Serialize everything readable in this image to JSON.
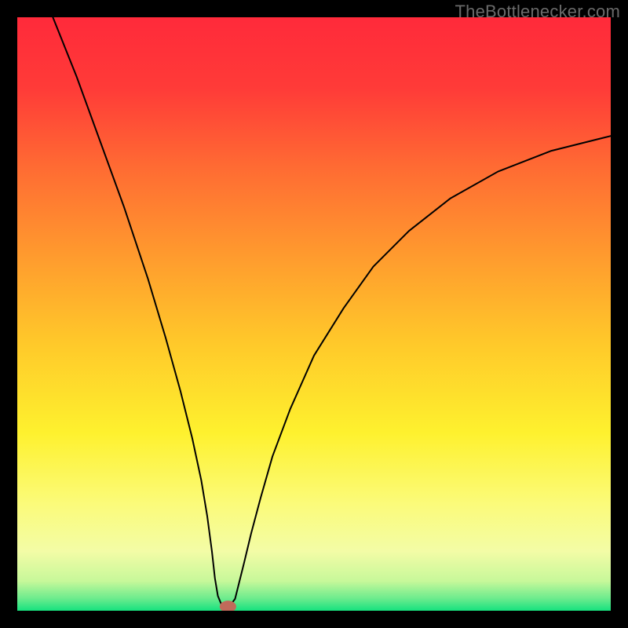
{
  "watermark": "TheBottlenecker.com",
  "chart_data": {
    "type": "line",
    "title": "",
    "xlabel": "",
    "ylabel": "",
    "xlim": [
      0,
      100
    ],
    "ylim": [
      0,
      100
    ],
    "background_gradient_stops": [
      {
        "offset": 0,
        "color": "#ff2a3a"
      },
      {
        "offset": 12,
        "color": "#ff3b38"
      },
      {
        "offset": 25,
        "color": "#ff6a33"
      },
      {
        "offset": 40,
        "color": "#ff9a2e"
      },
      {
        "offset": 55,
        "color": "#ffc92a"
      },
      {
        "offset": 70,
        "color": "#fef12e"
      },
      {
        "offset": 82,
        "color": "#fbfb7a"
      },
      {
        "offset": 90,
        "color": "#f3fca6"
      },
      {
        "offset": 95,
        "color": "#c7f89a"
      },
      {
        "offset": 98,
        "color": "#6aeb8d"
      },
      {
        "offset": 100,
        "color": "#16e27f"
      }
    ],
    "series": [
      {
        "name": "curve",
        "x": [
          6,
          10,
          14,
          18,
          22,
          25,
          27.5,
          29.5,
          31,
          32,
          32.8,
          33.3,
          33.8,
          34.5,
          35.2,
          35.8,
          36.7,
          37.2,
          38.2,
          39.4,
          41,
          43,
          46,
          50,
          55,
          60,
          66,
          73,
          81,
          90,
          100
        ],
        "y": [
          100,
          90,
          79,
          68,
          56,
          46,
          37,
          29,
          22,
          16,
          10,
          5.5,
          2.5,
          0.8,
          0.6,
          0.8,
          2,
          4,
          8,
          13,
          19,
          26,
          34,
          43,
          51,
          58,
          64,
          69.5,
          74,
          77.5,
          80
        ],
        "stroke": "#000000",
        "stroke_width": 2
      }
    ],
    "marker": {
      "x": 35.5,
      "y": 0.7,
      "rx": 1.4,
      "ry": 1.0,
      "fill": "#c06a5a"
    }
  }
}
